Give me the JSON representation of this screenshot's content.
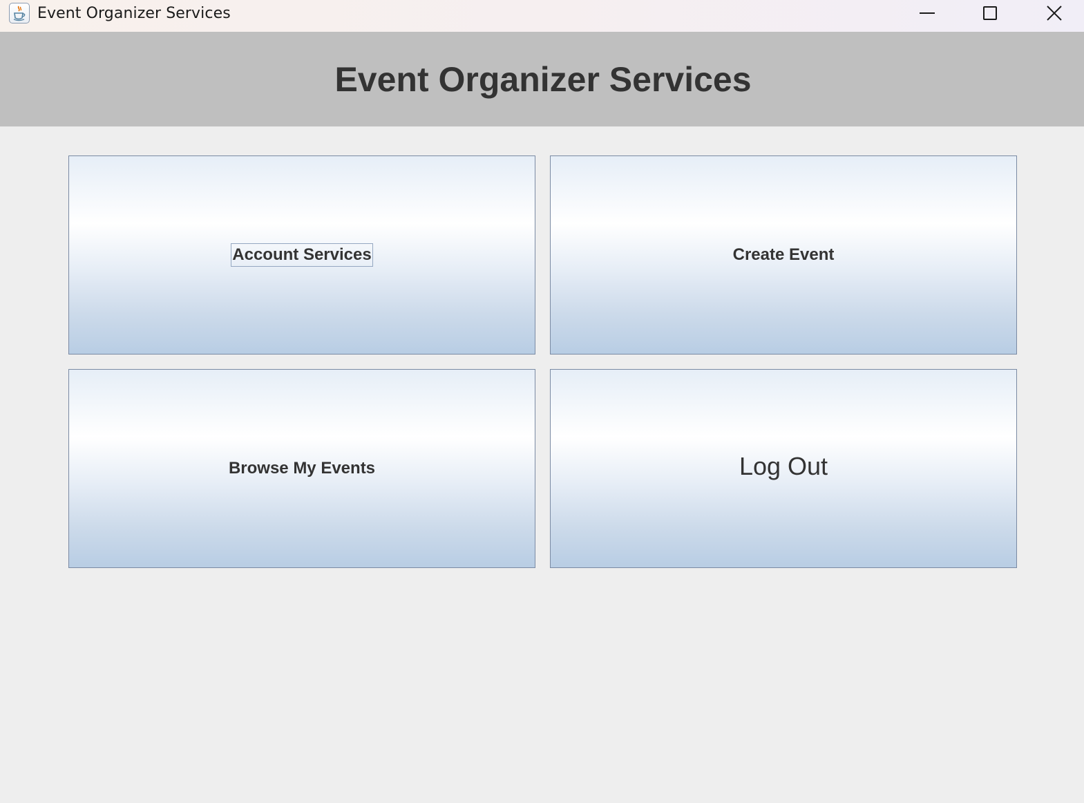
{
  "window": {
    "title": "Event Organizer Services",
    "icon": "java-coffee-icon",
    "controls": [
      "minimize-icon",
      "maximize-icon",
      "close-icon"
    ]
  },
  "header": {
    "title": "Event Organizer Services",
    "background": "#bfbfbf"
  },
  "menu": {
    "account_services": "Account Services",
    "create_event": "Create Event",
    "browse_my_events": "Browse My Events",
    "log_out": "Log Out",
    "focused": "account_services"
  },
  "colors": {
    "window_bg": "#eeeeee",
    "text": "#333333",
    "button_border": "#7a8aa3",
    "button_gradient_bottom": "#b8cde4"
  }
}
